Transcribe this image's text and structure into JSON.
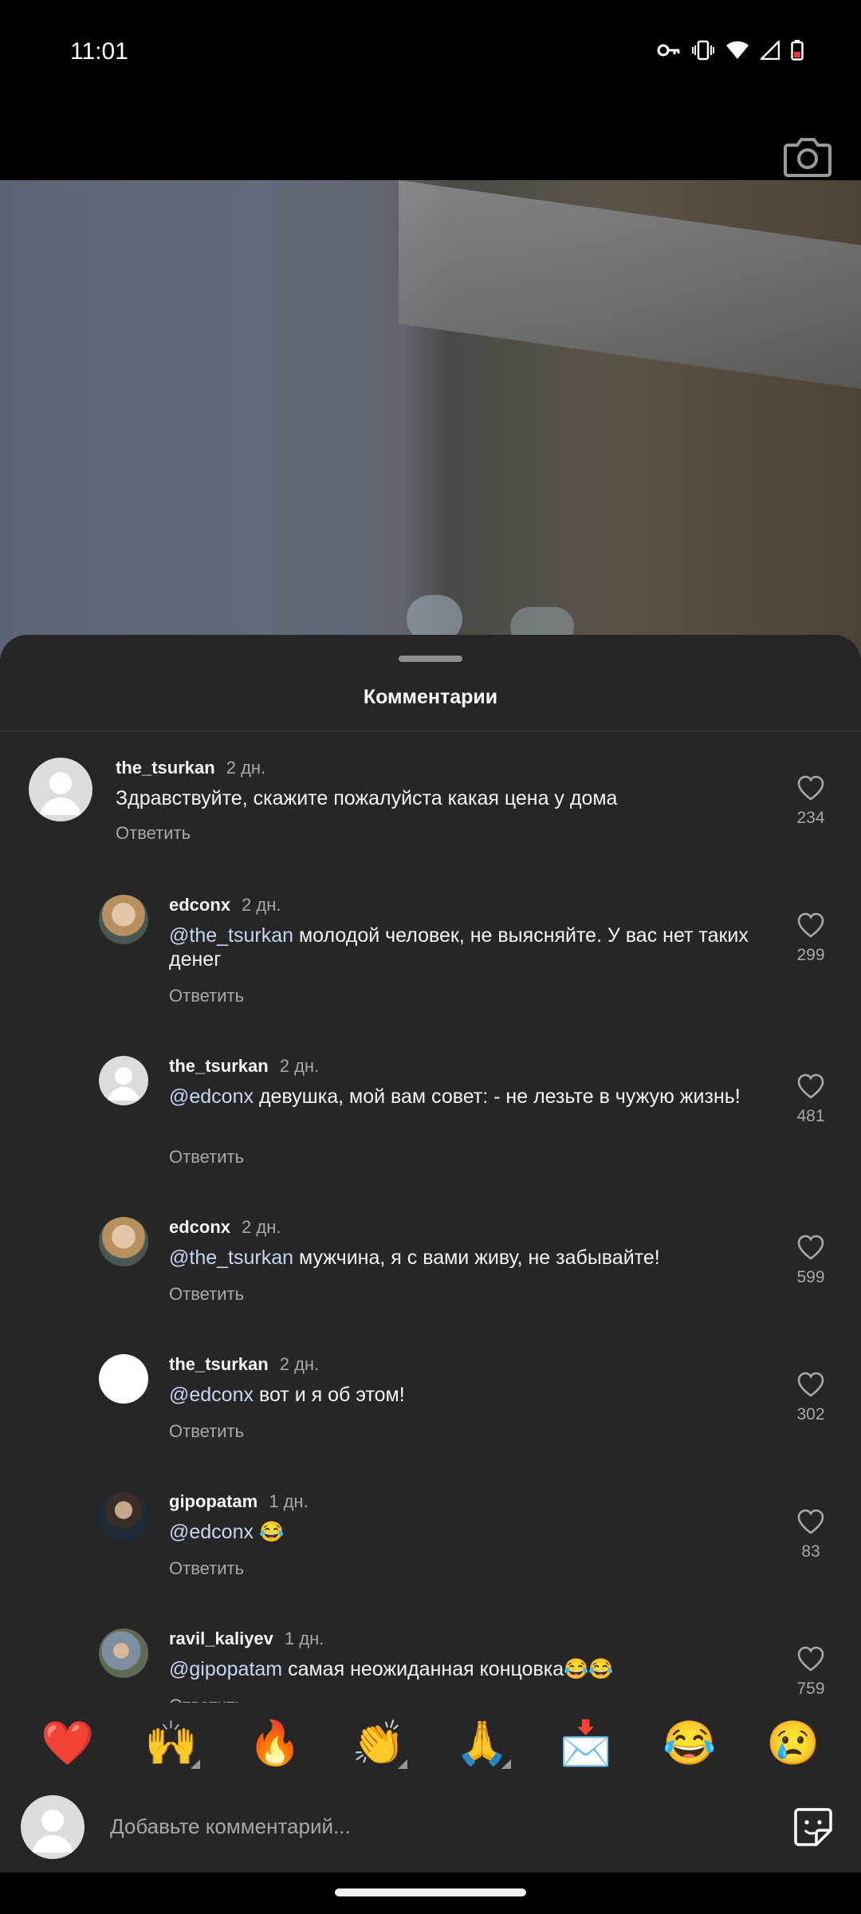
{
  "status": {
    "time": "11:01"
  },
  "sheet": {
    "title": "Комментарии"
  },
  "comments": [
    {
      "user": "the_tsurkan",
      "time": "2 дн.",
      "mention": "",
      "text": "Здравствуйте, скажите пожалуйста какая цена у дома",
      "reply": "Ответить",
      "likes": "234"
    },
    {
      "user": "edconx",
      "time": "2 дн.",
      "mention": "@the_tsurkan",
      "text": " молодой человек, не выясняйте. У вас нет таких денег",
      "reply": "Ответить",
      "likes": "299"
    },
    {
      "user": "the_tsurkan",
      "time": "2 дн.",
      "mention": "@edconx",
      "text": " девушка, мой вам совет: - не лезьте в чужую жизнь!",
      "reply": "Ответить",
      "likes": "481"
    },
    {
      "user": "edconx",
      "time": "2 дн.",
      "mention": "@the_tsurkan",
      "text": " мужчина, я с вами живу, не забывайте!",
      "reply": "Ответить",
      "likes": "599"
    },
    {
      "user": "the_tsurkan",
      "time": "2 дн.",
      "mention": "@edconx",
      "text": " вот и я об этом!",
      "reply": "Ответить",
      "likes": "302"
    },
    {
      "user": "gipopatam",
      "time": "1 дн.",
      "mention": "@edconx",
      "text": " 😂",
      "reply": "Ответить",
      "likes": "83"
    },
    {
      "user": "ravil_kaliyev",
      "time": "1 дн.",
      "mention": "@gipopatam",
      "text": " самая неожиданная концовка😂😂",
      "reply": "Ответить",
      "likes": "759"
    }
  ],
  "emoji_bar": [
    "❤️",
    "🙌",
    "🔥",
    "👏",
    "🙏",
    "📩",
    "😂",
    "😢"
  ],
  "input": {
    "placeholder": "Добавьте комментарий..."
  },
  "colors": {
    "sheet_bg": "#262626",
    "mention": "#c7d6f5",
    "secondary_text": "#a8a8a8"
  },
  "icons": [
    "key-icon",
    "vibrate-icon",
    "wifi-icon",
    "signal-icon",
    "battery-icon",
    "camera-icon",
    "heart-outline-icon",
    "sticker-icon"
  ]
}
